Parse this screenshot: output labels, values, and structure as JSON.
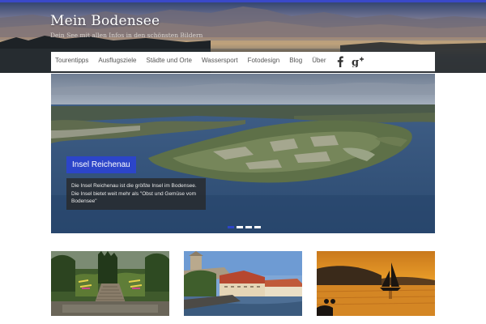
{
  "site": {
    "title": "Mein Bodensee",
    "tagline": "Dein See mit allen Infos in den schönsten Bildern"
  },
  "nav": {
    "items": [
      {
        "label": "Tourentipps"
      },
      {
        "label": "Ausflugsziele"
      },
      {
        "label": "Städte und Orte"
      },
      {
        "label": "Wassersport"
      },
      {
        "label": "Fotodesign"
      },
      {
        "label": "Blog"
      },
      {
        "label": "Über"
      }
    ],
    "social": [
      {
        "icon": "facebook-icon",
        "glyph": "f"
      },
      {
        "icon": "google-plus-icon",
        "glyph": "g+"
      }
    ]
  },
  "slider": {
    "caption_title": "Insel Reichenau",
    "caption_text": "Die Insel Reichenau ist die größte Insel im Bodensee. Die Insel bietet weit mehr als \"Obst und Gemüse vom Bodensee\"",
    "slide_count": 4,
    "active_slide": 1
  },
  "thumbnails": [
    {
      "subject": "garden-stairs-image"
    },
    {
      "subject": "town-harbor-image"
    },
    {
      "subject": "sunset-sailboat-image"
    }
  ],
  "colors": {
    "accent": "#2c45c9",
    "nav_text": "#555555",
    "header_title": "#ffffff"
  }
}
